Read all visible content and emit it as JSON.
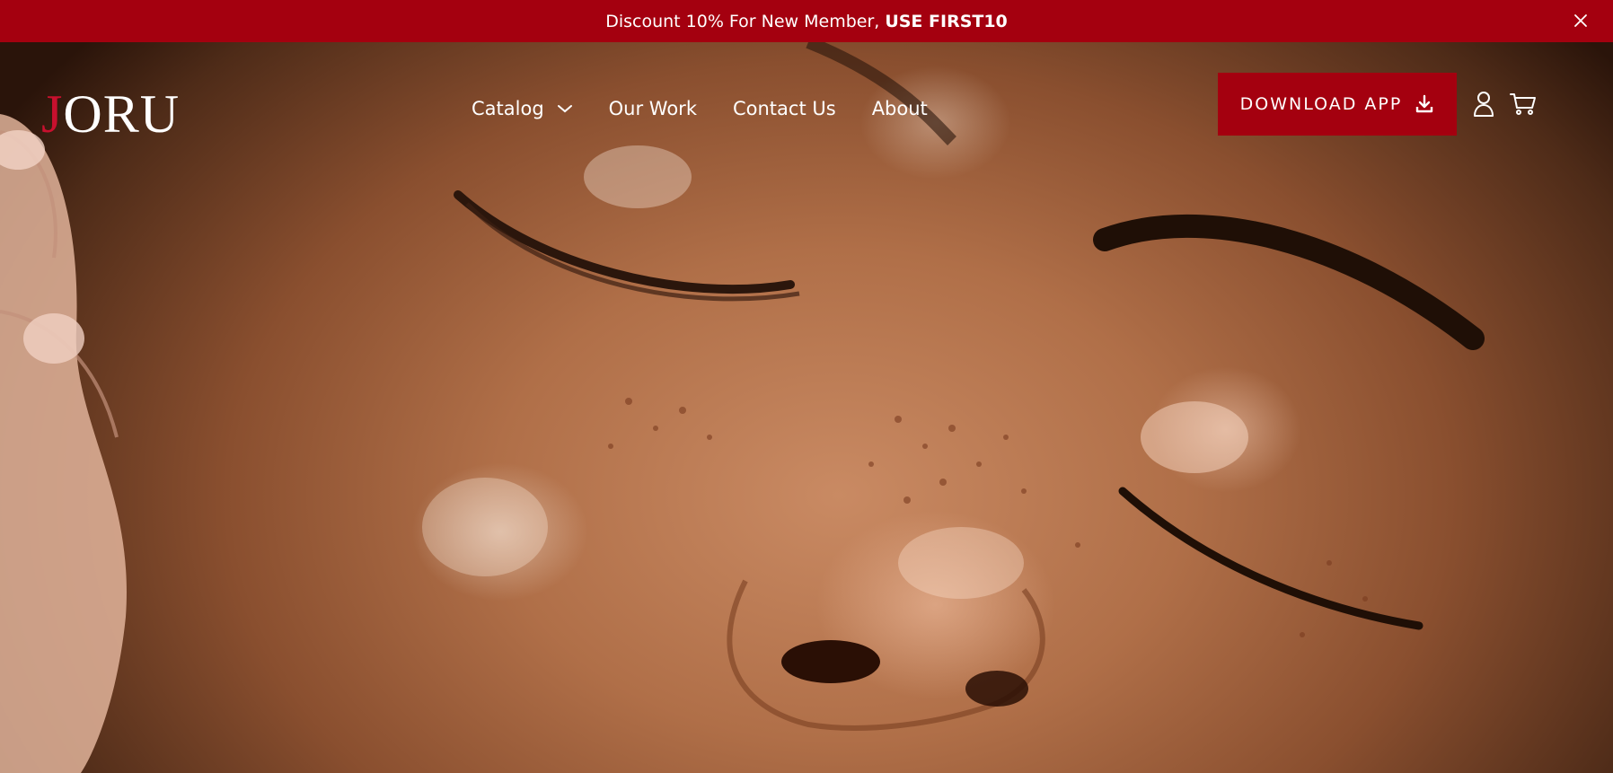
{
  "announcement": {
    "text": "Discount 10% For New Member,",
    "code": "USE FIRST10",
    "close_icon": "close-icon"
  },
  "header": {
    "logo": {
      "first_letter": "J",
      "rest": "ORU"
    },
    "nav": [
      {
        "label": "Catalog",
        "icon": "chevron-down-icon"
      },
      {
        "label": "Our Work"
      },
      {
        "label": "Contact Us"
      },
      {
        "label": "About"
      }
    ],
    "download_button": {
      "label": "DOWNLOAD APP",
      "icon": "download-icon"
    },
    "account_icon": "user-icon",
    "cart_icon": "cart-icon"
  },
  "hero": {
    "image": "close-up of a face with closed eyes, freckles and glowing skin, a hand at the left edge"
  },
  "colors": {
    "brand_red": "#a4000f",
    "logo_accent": "#c8102e",
    "text_light": "#ffffff"
  }
}
